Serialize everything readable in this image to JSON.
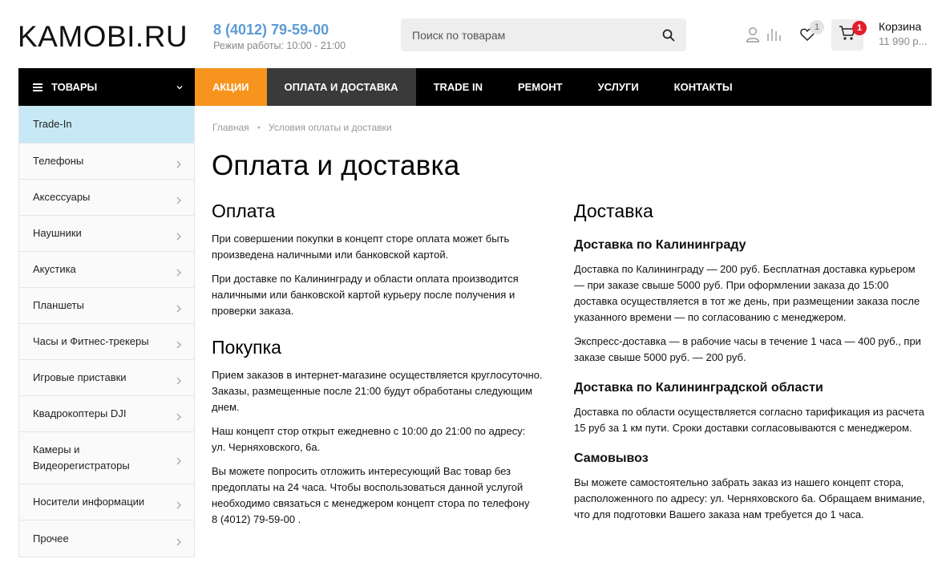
{
  "header": {
    "logo": "KAMOBI.RU",
    "phone": "8 (4012) 79-59-00",
    "hours": "Режим работы: 10:00 - 21:00",
    "search_placeholder": "Поиск по товарам",
    "favorites_count": "1",
    "cart_count": "1",
    "cart_label": "Корзина",
    "cart_sum": "11 990 р..."
  },
  "nav": {
    "catalog_label": "ТОВАРЫ",
    "items": [
      "АКЦИИ",
      "ОПЛАТА И ДОСТАВКА",
      "TRADE IN",
      "РЕМОНТ",
      "УСЛУГИ",
      "КОНТАКТЫ"
    ]
  },
  "sidebar": {
    "items": [
      "Trade-In",
      "Телефоны",
      "Аксессуары",
      "Наушники",
      "Акустика",
      "Планшеты",
      "Часы и Фитнес-трекеры",
      "Игровые приставки",
      "Квадрокоптеры DJI",
      "Камеры и Видеорегистраторы",
      "Носители информации",
      "Прочее"
    ]
  },
  "breadcrumb": {
    "home": "Главная",
    "separator": "•",
    "current": "Условия оплаты и доставки"
  },
  "page": {
    "title": "Оплата и доставка",
    "payment": {
      "heading": "Оплата",
      "p1": "При совершении покупки в концепт сторе оплата может быть произведена наличными или банковской картой.",
      "p2": "При доставке по Калининграду и области оплата производится наличными или банковской картой курьеру после получения и проверки заказа."
    },
    "purchase": {
      "heading": "Покупка",
      "p1": "Прием заказов в интернет-магазине осуществляется круглосуточно. Заказы, размещенные после 21:00 будут обработаны следующим днем.",
      "p2": "Наш концепт стор открыт ежедневно с 10:00 до 21:00 по адресу: ул. Черняховского, 6а.",
      "p3": "Вы можете попросить отложить интересующий Вас товар без предоплаты на 24 часа. Чтобы воспользоваться данной услугой необходимо связаться с менеджером концепт стора по телефону 8 (4012) 79-59-00 ."
    },
    "delivery": {
      "heading": "Доставка",
      "city_heading": "Доставка по Калининграду",
      "city_p1": "Доставка по Калининграду — 200 руб. Бесплатная доставка курьером — при заказе свыше 5000 руб. При оформлении заказа до 15:00 доставка осуществляется в тот же день, при размещении заказа после указанного времени — по согласованию с менеджером.",
      "city_p2": "Экспресс-доставка — в рабочие часы в течение 1 часа — 400 руб., при заказе свыше 5000 руб. — 200 руб.",
      "region_heading": "Доставка по Калининградской области",
      "region_p1": "Доставка по области осуществляется согласно тарификация из расчета 15 руб за 1 км пути. Сроки доставки согласовываются с менеджером.",
      "pickup_heading": "Самовывоз",
      "pickup_p1": "Вы можете самостоятельно забрать заказ из нашего концепт стора, расположенного по адресу: ул. Черняховского 6а. Обращаем внимание, что для подготовки Вашего заказа нам требуется до 1 часа."
    }
  },
  "colors": {
    "phone": "#5b9bd5",
    "promo": "#f7941d",
    "active_nav": "#3a3a3a",
    "sidebar_highlight": "#c7e9f5",
    "cart_badge": "#e31d2b"
  }
}
